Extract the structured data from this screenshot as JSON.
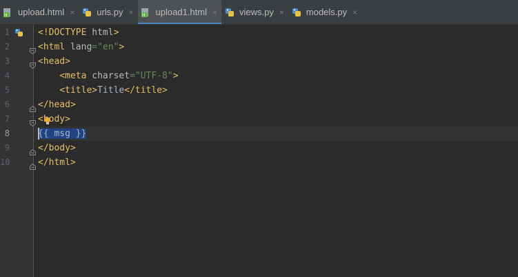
{
  "tabs": [
    {
      "label": "upload.html",
      "type": "html",
      "active": false
    },
    {
      "label": "urls.py",
      "type": "py",
      "active": false
    },
    {
      "label": "upload1.html",
      "type": "html",
      "active": true
    },
    {
      "label": "views.py",
      "type": "py",
      "active": false
    },
    {
      "label": "models.py",
      "type": "py",
      "active": false
    }
  ],
  "close_glyph": "×",
  "gutter": {
    "line_numbers": [
      "1",
      "2",
      "3",
      "4",
      "5",
      "6",
      "7",
      "8",
      "9",
      "10"
    ],
    "current_line": "8",
    "gutter_icon": "python-icon"
  },
  "code": {
    "l1": {
      "t1": "<!DOCTYPE",
      "t2": " html",
      "t3": ">"
    },
    "l2": {
      "t1": "<html",
      "t2": " lang",
      "t3": "=",
      "t4": "\"en\"",
      "t5": ">"
    },
    "l3": {
      "t1": "<head>"
    },
    "l4": {
      "indent": "    ",
      "t1": "<meta",
      "t2": " charset",
      "t3": "=",
      "t4": "\"UTF-8\"",
      "t5": ">"
    },
    "l5": {
      "indent": "    ",
      "t1": "<title>",
      "t2": "Title",
      "t3": "</title>"
    },
    "l6": {
      "t1": "</head>"
    },
    "l7": {
      "t1": "<",
      "t2": "body>"
    },
    "l8": {
      "t1": "{{ msg }}"
    },
    "l9": {
      "t1": "</body>"
    },
    "l10": {
      "t1": "</html>"
    }
  },
  "colors": {
    "tag": "#e8bf6a",
    "attribute": "#bababa",
    "string": "#6a8759",
    "text": "#a9b7c6",
    "selection": "#214283",
    "active_tab_underline": "#4a88c7"
  }
}
